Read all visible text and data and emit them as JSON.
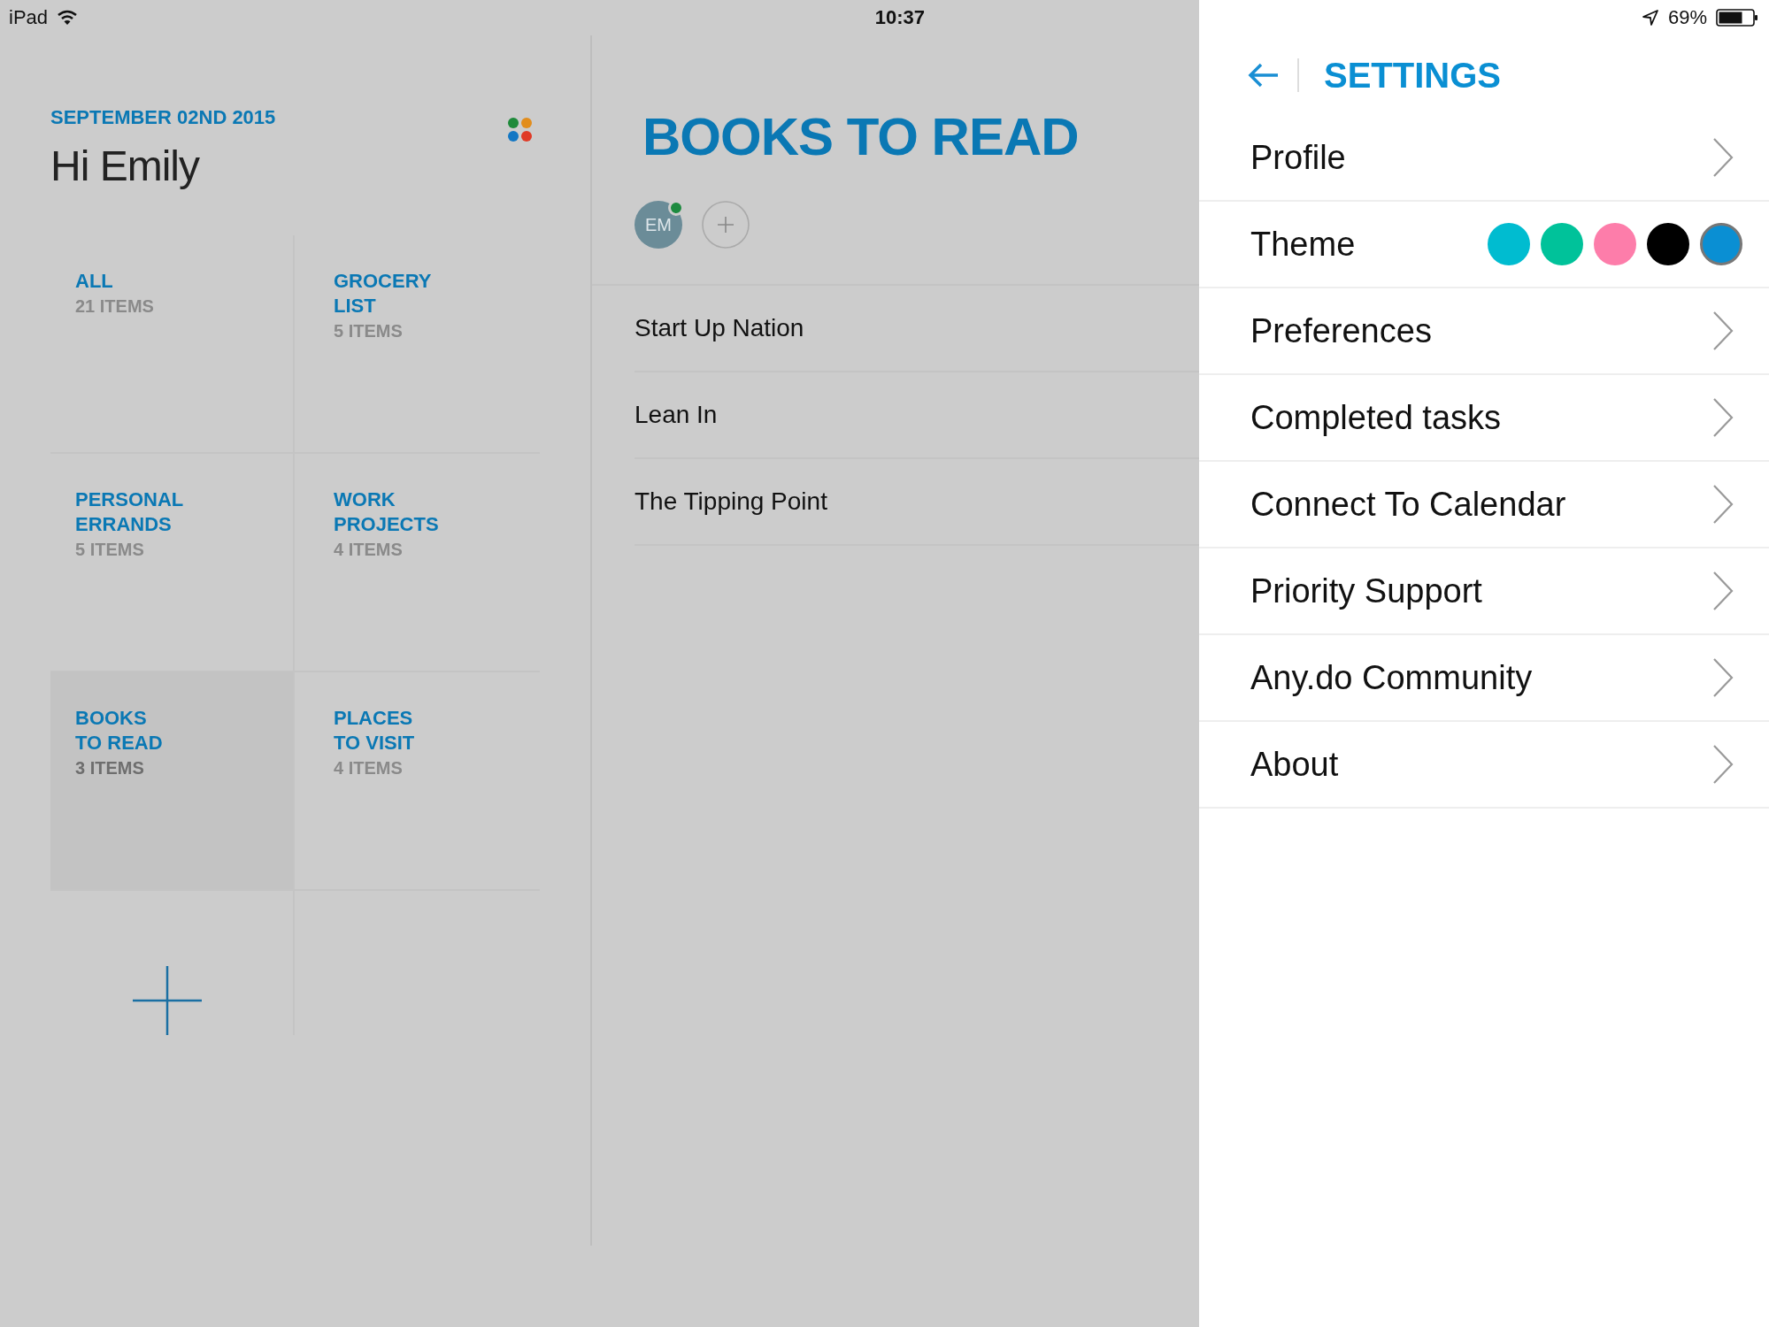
{
  "status_bar": {
    "device": "iPad",
    "time": "10:37",
    "battery": "69%"
  },
  "sidebar": {
    "date": "SEPTEMBER 02ND 2015",
    "greeting": "Hi Emily",
    "lists": [
      {
        "name_lines": [
          "ALL"
        ],
        "count": "21 ITEMS",
        "selected": false
      },
      {
        "name_lines": [
          "GROCERY",
          "LIST"
        ],
        "count": "5 ITEMS",
        "selected": false
      },
      {
        "name_lines": [
          "PERSONAL",
          "ERRANDS"
        ],
        "count": "5 ITEMS",
        "selected": false
      },
      {
        "name_lines": [
          "WORK",
          "PROJECTS"
        ],
        "count": "4 ITEMS",
        "selected": false
      },
      {
        "name_lines": [
          "BOOKS",
          "TO READ"
        ],
        "count": "3 ITEMS",
        "selected": true
      },
      {
        "name_lines": [
          "PLACES",
          "TO VISIT"
        ],
        "count": "4 ITEMS",
        "selected": false
      }
    ]
  },
  "list_view": {
    "title": "BOOKS TO READ",
    "member": {
      "initials": "EM",
      "online": true
    },
    "tasks": [
      "Start Up Nation",
      "Lean In",
      "The Tipping Point"
    ]
  },
  "settings": {
    "title": "SETTINGS",
    "items": [
      {
        "kind": "link",
        "label": "Profile"
      },
      {
        "kind": "theme",
        "label": "Theme",
        "swatches": [
          {
            "color": "#00bcd0",
            "selected": false
          },
          {
            "color": "#00c29a",
            "selected": false
          },
          {
            "color": "#fd7daa",
            "selected": false
          },
          {
            "color": "#000000",
            "selected": false
          },
          {
            "color": "#0a8fd3",
            "selected": true
          }
        ]
      },
      {
        "kind": "link",
        "label": "Preferences"
      },
      {
        "kind": "link",
        "label": "Completed tasks"
      },
      {
        "kind": "link",
        "label": "Connect To Calendar"
      },
      {
        "kind": "link",
        "label": "Priority Support"
      },
      {
        "kind": "link",
        "label": "Any.do Community"
      },
      {
        "kind": "link",
        "label": "About"
      }
    ]
  }
}
